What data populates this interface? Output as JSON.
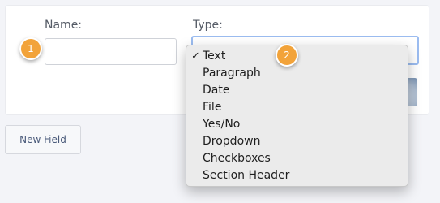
{
  "form": {
    "name_label": "Name:",
    "type_label": "Type:",
    "name_value": "",
    "type_selected": "Text"
  },
  "type_menu": {
    "check_glyph": "✓",
    "items": [
      "Text",
      "Paragraph",
      "Date",
      "File",
      "Yes/No",
      "Dropdown",
      "Checkboxes",
      "Section Header"
    ]
  },
  "badges": {
    "one": "1",
    "two": "2"
  },
  "actions": {
    "new_field_label": "New Field"
  },
  "colors": {
    "badge": "#f2a33a",
    "focus_border": "#9bbcf0",
    "side_button": "#5d7ca3",
    "background": "#f3f4f8"
  }
}
